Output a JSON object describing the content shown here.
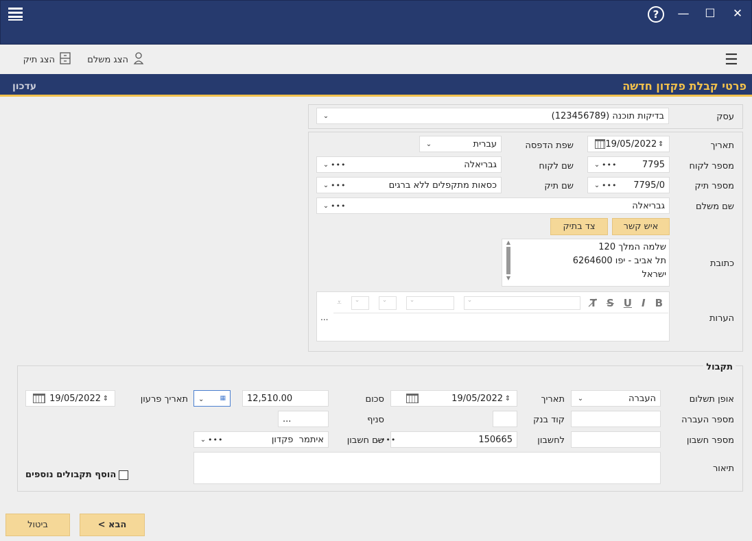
{
  "window": {
    "help_glyph": "?",
    "minimize_glyph": "—",
    "maximize_glyph": "☐",
    "close_glyph": "✕"
  },
  "toolbar": {
    "show_payer_label": "הצג משלם",
    "show_file_label": "הצג תיק",
    "menu_glyph": "☰"
  },
  "header": {
    "title": "פרטי קבלת פקדון חדשה",
    "mode": "עדכון"
  },
  "business": {
    "label": "עסק",
    "value": "בדיקות תוכנה (123456789)"
  },
  "details": {
    "date_label": "תאריך",
    "date_value": "19/05/2022",
    "print_lang_label": "שפת הדפסה",
    "print_lang_value": "עברית",
    "client_no_label": "מספר לקוח",
    "client_no_value": "7795",
    "client_name_label": "שם לקוח",
    "client_name_value": "גבריאלה",
    "file_no_label": "מספר תיק",
    "file_no_value": "7795/0",
    "file_name_label": "שם תיק",
    "file_name_value": "כסאות מתקפלים ללא ברגים",
    "payer_label": "שם משלם",
    "payer_value": "גבריאלה",
    "contact_button": "איש קשר",
    "party_button": "צד בתיק",
    "address_label": "כתובת",
    "address_lines": {
      "line1": "שלמה המלך 120",
      "line2": "תל אביב - יפו 6264600",
      "line3": "ישראל"
    },
    "notes_label": "הערות",
    "notes_more": "..."
  },
  "editor": {
    "bold": "B",
    "italic": "I",
    "underline": "U",
    "strike": "S",
    "clear": "T̸"
  },
  "receipt": {
    "section_title": "תקבול",
    "payment_method_label": "אופן תשלום",
    "payment_method_value": "העברה",
    "date_label": "תאריך",
    "date_value": "19/05/2022",
    "amount_label": "סכום",
    "amount_value": "12,510.00",
    "due_date_label": "תאריך פרעון",
    "due_date_value": "19/05/2022",
    "transfer_no_label": "מספר העברה",
    "bank_code_label": "קוד בנק",
    "branch_label": "סניף",
    "branch_value": "...",
    "account_no_label": "מספר חשבון",
    "to_account_label": "לחשבון",
    "to_account_value": "150665",
    "account_name_label": "שם חשבון",
    "account_name_value": "איתמר  פקדון",
    "description_label": "תיאור",
    "add_more_label": "הוסף תקבולים נוספים"
  },
  "footer": {
    "next_label": "הבא >",
    "cancel_label": "ביטול"
  },
  "colors": {
    "title_bar": "#263a6e",
    "accent": "#f2c14c",
    "button": "#f5d898",
    "background": "#eeeeee"
  }
}
